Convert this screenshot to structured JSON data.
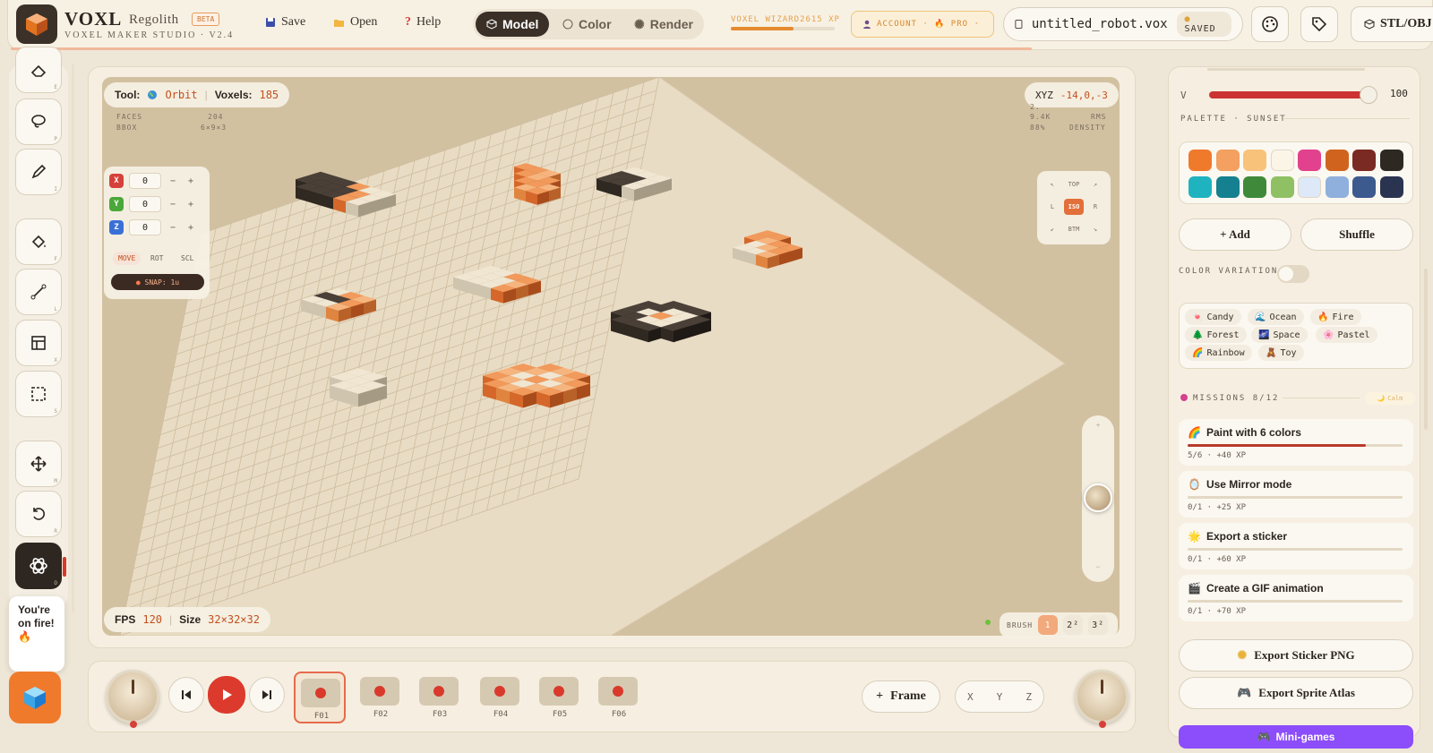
{
  "header": {
    "brand": "VOXL",
    "brand_sub": "Regolith",
    "beta": "BETA",
    "studio": "VOXEL MAKER STUDIO · V2.4",
    "save": "Save",
    "open": "Open",
    "help": "Help",
    "modes": [
      "Model",
      "Color",
      "Render"
    ],
    "active_mode": "Model",
    "xp_label": "VOXEL WIZARD2615 XP",
    "xp_progress": 0.6,
    "account": "ACCOUNT · 🔥 PRO ·",
    "filename": "untitled_robot.vox",
    "saved": "SAVED",
    "export_label": "STL/OBJ",
    "icons": [
      "cube-logo-icon",
      "save-icon",
      "folder-icon",
      "help-icon",
      "model-icon",
      "color-icon",
      "render-icon",
      "user-icon",
      "file-icon",
      "palette-icon",
      "tag-icon",
      "export-cube-icon"
    ]
  },
  "tools": {
    "keys": [
      "E",
      "P",
      "I",
      "F",
      "L",
      "X",
      "S",
      "M",
      "R",
      "O"
    ],
    "icons": [
      "eraser-icon",
      "lasso-icon",
      "pencil-icon",
      "fill-icon",
      "line-icon",
      "frame-icon",
      "select-icon",
      "move-icon",
      "rotate-icon",
      "orbit-icon"
    ],
    "active": "orbit-icon"
  },
  "toast": {
    "text": "You're on fire!",
    "emoji": "🔥"
  },
  "viewport": {
    "tool_label": "Tool:",
    "tool_name": "Orbit",
    "voxels_label": "Voxels:",
    "voxels": "185",
    "faces_label": "FACES",
    "faces": "204",
    "bbox_label": "BBOX",
    "bbox": "6×9×3",
    "xyz_label": "XYZ",
    "xyz": "-14,0,-3",
    "stat_a": "2.",
    "stat_b": "9.4K",
    "stat_b_label": "RMS",
    "stat_c": "88%",
    "stat_c_label": "DENSITY",
    "axes": [
      {
        "name": "X",
        "value": "0",
        "color": "#d6403a"
      },
      {
        "name": "Y",
        "value": "0",
        "color": "#4aa83a"
      },
      {
        "name": "Z",
        "value": "0",
        "color": "#3a6fd6"
      }
    ],
    "transform_modes": [
      "MOVE",
      "ROT",
      "SCL"
    ],
    "snap": "SNAP: 1u",
    "view_labels": [
      "TOP",
      "L",
      "ISO",
      "R",
      "BTM"
    ],
    "fps_label": "FPS",
    "fps": "120",
    "size_label": "Size",
    "size": "32×32×32",
    "brush_label": "BRUSH",
    "brush_sizes": [
      "1",
      "2²",
      "3²"
    ]
  },
  "timeline": {
    "frames": [
      "F01",
      "F02",
      "F03",
      "F04",
      "F05",
      "F06"
    ],
    "selected": "F01",
    "add_frame": "Frame",
    "axes": [
      "X",
      "Y",
      "Z"
    ]
  },
  "right": {
    "v_label": "V",
    "v_value": "100",
    "palette_label": "PALETTE · SUNSET",
    "swatches": [
      "#f07a2c",
      "#f3a060",
      "#f8c27a",
      "#fbf5e8",
      "#e2418e",
      "#d0641f",
      "#7a2a22",
      "#2d2822",
      "#1fb3c0",
      "#15808f",
      "#3e8a3a",
      "#8fc063",
      "#dde8f8",
      "#8fb0dc",
      "#3c5a8e",
      "#2a3350"
    ],
    "add": "+ Add",
    "shuffle": "Shuffle",
    "color_variation": "COLOR VARIATION",
    "themes": [
      {
        "label": "Candy",
        "emoji": "🍬"
      },
      {
        "label": "Ocean",
        "emoji": "🌊"
      },
      {
        "label": "Fire",
        "emoji": "🔥"
      },
      {
        "label": "Forest",
        "emoji": "🌲"
      },
      {
        "label": "Space",
        "emoji": "🌌"
      },
      {
        "label": "Pastel",
        "emoji": "🌸"
      },
      {
        "label": "Rainbow",
        "emoji": "🌈"
      },
      {
        "label": "Toy",
        "emoji": "🧸"
      }
    ],
    "missions_label": "MISSIONS 8/12",
    "calm": "Calm",
    "missions": [
      {
        "emoji": "🌈",
        "title": "Paint with 6 colors",
        "meta": "5/6 · +40 XP",
        "progress": 0.83
      },
      {
        "emoji": "🪞",
        "title": "Use Mirror mode",
        "meta": "0/1 · +25 XP",
        "progress": 0
      },
      {
        "emoji": "🌟",
        "title": "Export a sticker",
        "meta": "0/1 · +60 XP",
        "progress": 0
      },
      {
        "emoji": "🎬",
        "title": "Create a GIF animation",
        "meta": "0/1 · +70 XP",
        "progress": 0
      }
    ],
    "export_sticker": "Export Sticker PNG",
    "export_sprite": "Export Sprite Atlas",
    "mini_games": "Mini-games"
  }
}
